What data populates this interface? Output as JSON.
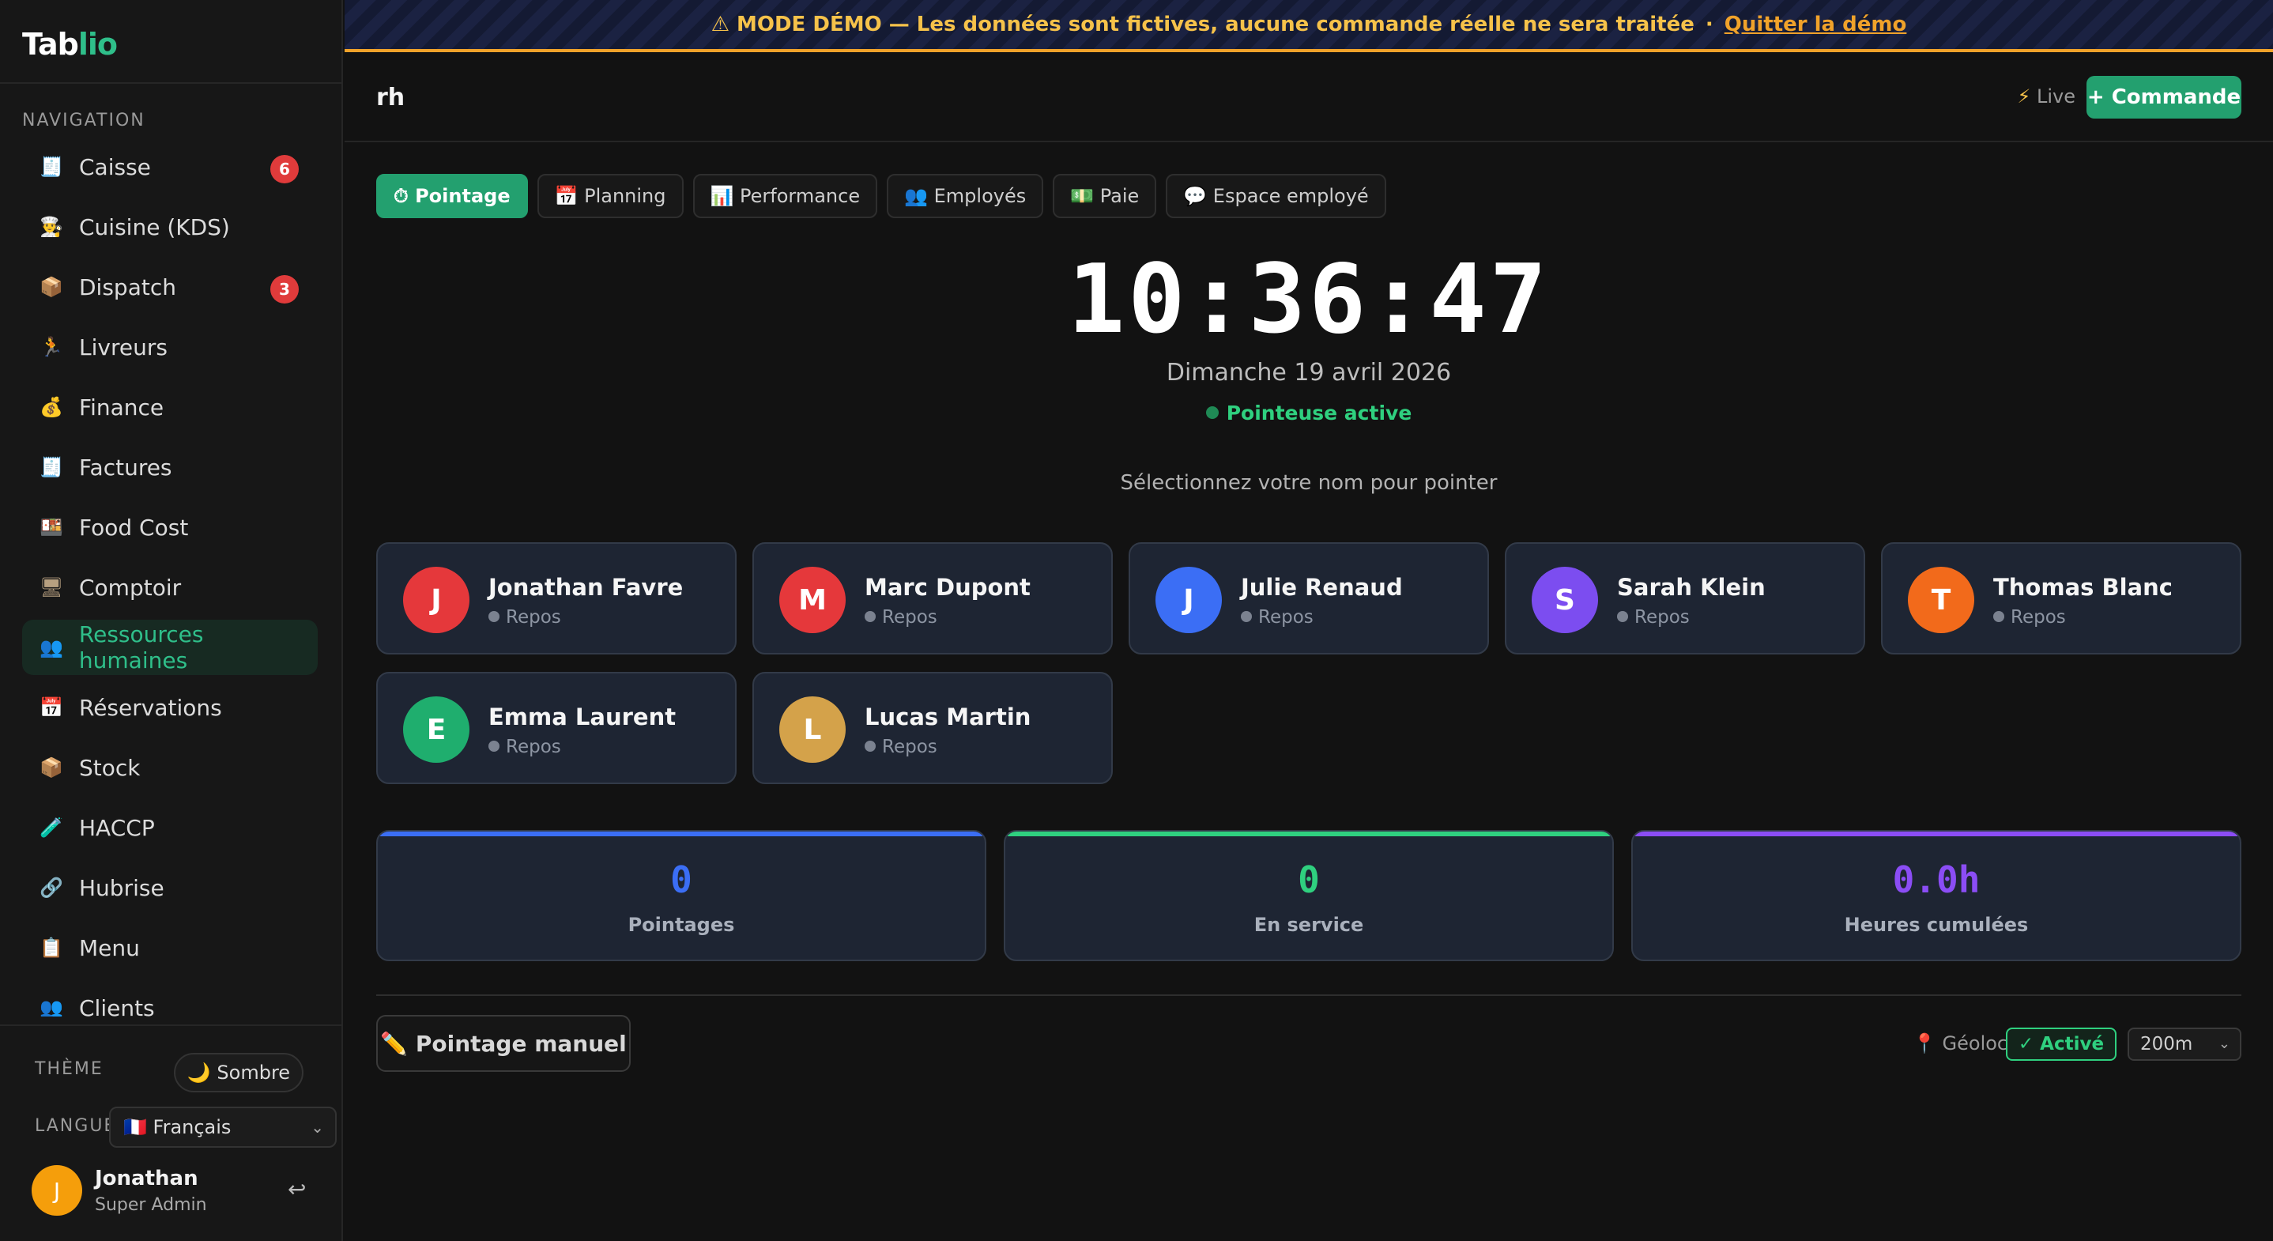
{
  "app": {
    "logo_main": "Tab",
    "logo_accent": "lio"
  },
  "sidebar": {
    "nav_title": "NAVIGATION",
    "items": [
      {
        "label": "Caisse",
        "icon": "🧾",
        "badge": "6"
      },
      {
        "label": "Cuisine (KDS)",
        "icon": "👨‍🍳",
        "badge": ""
      },
      {
        "label": "Dispatch",
        "icon": "📦",
        "badge": "3"
      },
      {
        "label": "Livreurs",
        "icon": "🏃",
        "badge": ""
      },
      {
        "label": "Finance",
        "icon": "💰",
        "badge": ""
      },
      {
        "label": "Factures",
        "icon": "🧾",
        "badge": ""
      },
      {
        "label": "Food Cost",
        "icon": "🍱",
        "badge": ""
      },
      {
        "label": "Comptoir",
        "icon": "🖥",
        "badge": ""
      },
      {
        "label": "Ressources humaines",
        "icon": "👥",
        "badge": "",
        "active": true
      },
      {
        "label": "Réservations",
        "icon": "📅",
        "badge": ""
      },
      {
        "label": "Stock",
        "icon": "📦",
        "badge": ""
      },
      {
        "label": "HACCP",
        "icon": "🧪",
        "badge": ""
      },
      {
        "label": "Hubrise",
        "icon": "🔗",
        "badge": ""
      },
      {
        "label": "Menu",
        "icon": "📋",
        "badge": ""
      },
      {
        "label": "Clients",
        "icon": "👥",
        "badge": ""
      }
    ],
    "theme_label": "THÈME",
    "theme_value": "🌙 Sombre",
    "lang_label": "LANGUE",
    "lang_value": "🇫🇷 Français",
    "user": {
      "initial": "J",
      "name": "Jonathan",
      "role": "Super Admin"
    }
  },
  "banner": {
    "text": "⚠ MODE DÉMO — Les données sont fictives, aucune commande réelle ne sera traitée",
    "separator": "·",
    "quit_label": "Quitter la démo"
  },
  "topbar": {
    "title": "rh",
    "live_label": "Live",
    "new_order_label": "+ Commande"
  },
  "tabs": [
    {
      "label": "⏱ Pointage",
      "active": true
    },
    {
      "label": "📅 Planning"
    },
    {
      "label": "📊 Performance"
    },
    {
      "label": "👥 Employés"
    },
    {
      "label": "💵 Paie"
    },
    {
      "label": "💬 Espace employé"
    }
  ],
  "clock": {
    "time": "10:36:47",
    "date": "Dimanche 19 avril 2026",
    "status": "Pointeuse active",
    "hint": "Sélectionnez votre nom pour pointer"
  },
  "employees": [
    {
      "initial": "J",
      "name": "Jonathan Favre",
      "status": "Repos",
      "color": "#e5383b"
    },
    {
      "initial": "M",
      "name": "Marc Dupont",
      "status": "Repos",
      "color": "#e5383b"
    },
    {
      "initial": "J",
      "name": "Julie Renaud",
      "status": "Repos",
      "color": "#3b6ef5"
    },
    {
      "initial": "S",
      "name": "Sarah Klein",
      "status": "Repos",
      "color": "#7c4df0"
    },
    {
      "initial": "T",
      "name": "Thomas Blanc",
      "status": "Repos",
      "color": "#f26a1b"
    },
    {
      "initial": "E",
      "name": "Emma Laurent",
      "status": "Repos",
      "color": "#1fae6e"
    },
    {
      "initial": "L",
      "name": "Lucas Martin",
      "status": "Repos",
      "color": "#d4a24a"
    }
  ],
  "stats": [
    {
      "value": "0",
      "label": "Pointages",
      "color": "#3b6ef5"
    },
    {
      "value": "0",
      "label": "En service",
      "color": "#2fd07f"
    },
    {
      "value": "0.0h",
      "label": "Heures cumulées",
      "color": "#8b4df5"
    }
  ],
  "bottom": {
    "manual_label": "✏️ Pointage manuel",
    "geo_label": "Géoloc",
    "geo_status": "✓ Activé",
    "radius_value": "200m"
  }
}
